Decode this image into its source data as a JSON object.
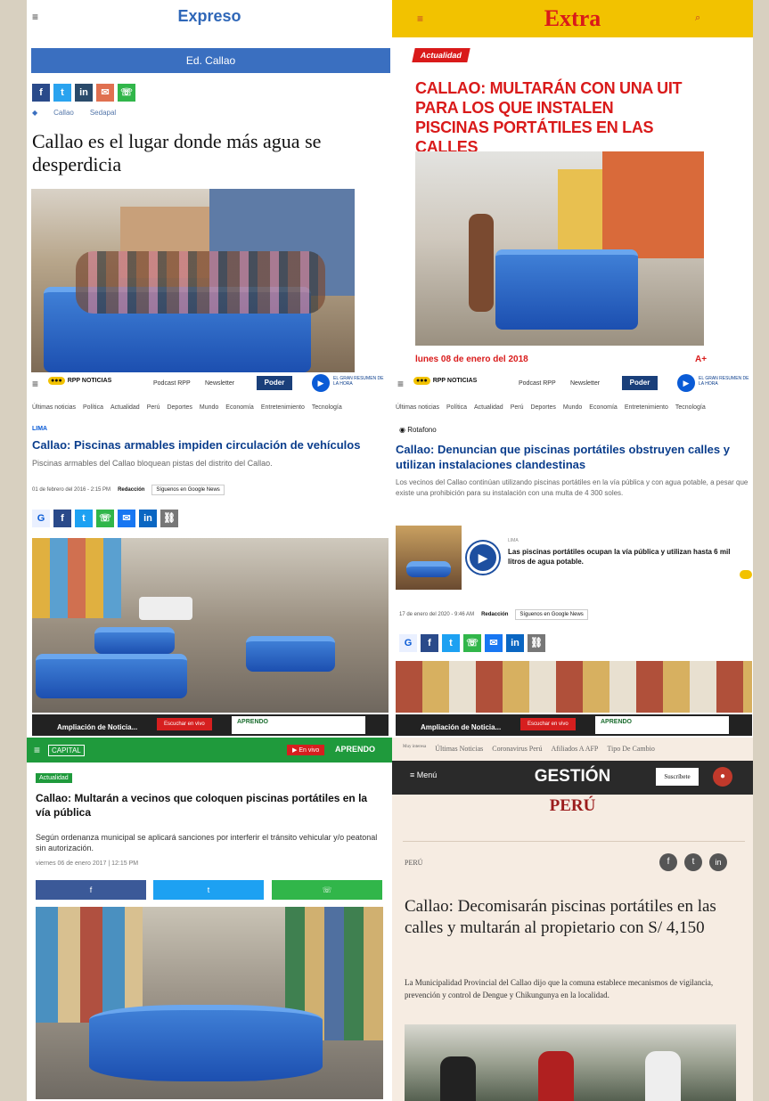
{
  "expreso": {
    "logo": "Expreso",
    "section_bar": "Ed. Callao",
    "tags": [
      "Callao",
      "Sedapal"
    ],
    "headline": "Callao es el lugar donde más agua se desperdicia"
  },
  "extra": {
    "logo": "Extra",
    "category": "Actualidad",
    "headline": "CALLAO: MULTARÁN CON UNA UIT PARA LOS QUE INSTALEN PISCINAS PORTÁTILES EN LAS CALLES",
    "date": "lunes 08 de enero del 2018",
    "font_toggle": "A+"
  },
  "rpp_left": {
    "logo": "RPP NOTICIAS",
    "podcast": "Podcast RPP",
    "newsletter": "Newsletter",
    "poder": "Poder",
    "summary": "EL GRAN RESUMEN DE LA HORA",
    "nav": [
      "Últimas noticias",
      "Política",
      "Actualidad",
      "Perú",
      "Deportes",
      "Mundo",
      "Economía",
      "Entretenimiento",
      "Tecnología"
    ],
    "kicker": "LIMA",
    "headline": "Callao: Piscinas armables impiden circulación de vehículos",
    "subhead": "Piscinas armables del Callao bloquean pistas del distrito del Callao.",
    "date": "01 de febrero del 2016 - 2:15 PM",
    "byline": "Redacción",
    "google_news": "Síguenos en Google News",
    "player_title": "Ampliación de Noticia...",
    "listen": "Escuchar en vivo",
    "aprendo": "APRENDO"
  },
  "rpp_right": {
    "logo": "RPP NOTICIAS",
    "podcast": "Podcast RPP",
    "newsletter": "Newsletter",
    "poder": "Poder",
    "summary": "EL GRAN RESUMEN DE LA HORA",
    "nav": [
      "Últimas noticias",
      "Política",
      "Actualidad",
      "Perú",
      "Deportes",
      "Mundo",
      "Economía",
      "Entretenimiento",
      "Tecnología"
    ],
    "kicker": "Rotafono",
    "headline": "Callao: Denuncian que piscinas portátiles obstruyen calles y utilizan instalaciones clandestinas",
    "body": "Los vecinos del Callao continúan utilizando piscinas portátiles en la vía pública y con agua potable, a pesar que existe una prohibición para su instalación con una multa de 4 300 soles.",
    "video_kicker": "LIMA",
    "video_caption": "Las piscinas portátiles ocupan la vía pública y utilizan hasta 6 mil litros de agua potable.",
    "date": "17 de enero del 2020 - 9:46 AM",
    "byline": "Redacción",
    "google_news": "Síguenos en Google News",
    "player_title": "Ampliación de Noticia...",
    "listen": "Escuchar en vivo",
    "aprendo": "APRENDO"
  },
  "capital": {
    "logo": "CAPITAL",
    "live": "En vivo",
    "aprendo": "APRENDO",
    "category": "Actualidad",
    "headline": "Callao: Multarán a vecinos que coloquen piscinas portátiles en la vía pública",
    "subhead": "Según ordenanza municipal se aplicará sanciones por interferir el tránsito vehicular y/o peatonal sin autorización.",
    "date": "viernes 06 de enero 2017 | 12:15 PM"
  },
  "gestion": {
    "top_nav": [
      "Muy interesa",
      "Últimas Noticias",
      "Coronavirus Perú",
      "Afiliados A AFP",
      "Tipo De Cambio"
    ],
    "menu": "Menú",
    "logo": "GESTIÓN",
    "subscribe": "Suscríbete",
    "section": "PERÚ",
    "kicker": "PERÚ",
    "headline": "Callao: Decomisarán piscinas portátiles en las calles y multarán al propietario con S/ 4,150",
    "body": "La Municipalidad Provincial del Callao dijo que la comuna establece mecanismos de vigilancia, prevención y control de Dengue y Chikungunya en la localidad."
  },
  "colors": {
    "expreso_blue": "#2f67b8",
    "extra_yellow": "#f2c200",
    "extra_red": "#d91a1a",
    "rpp_blue": "#0a3d8c",
    "capital_green": "#1f9a3c",
    "gestion_red": "#9b1c1c"
  }
}
